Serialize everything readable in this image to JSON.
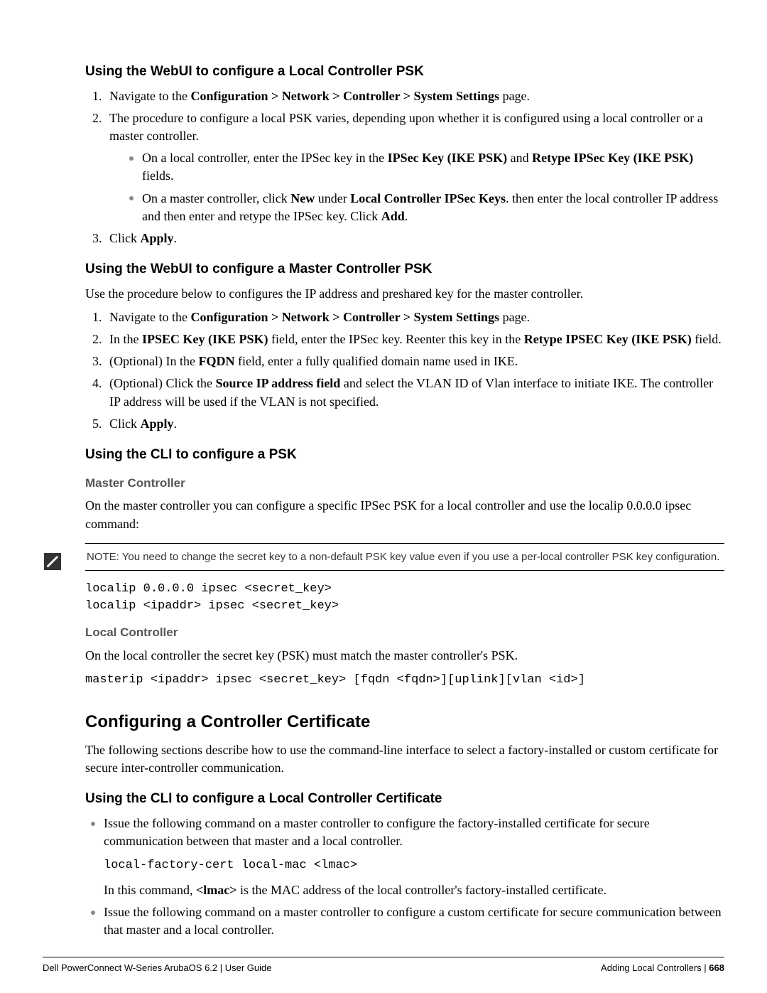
{
  "h1": "Using the WebUI to configure a Local Controller PSK",
  "s1_li1_a": "Navigate to the ",
  "s1_li1_b": "Configuration > Network > Controller > System Settings",
  "s1_li1_c": " page.",
  "s1_li2": "The procedure to configure a local PSK varies, depending upon whether it is configured using a local controller or a master controller.",
  "s1_li2_s1_a": "On a local controller, enter the IPSec key in the ",
  "s1_li2_s1_b": "IPSec Key (IKE PSK)",
  "s1_li2_s1_c": " and ",
  "s1_li2_s1_d": "Retype IPSec Key (IKE PSK)",
  "s1_li2_s1_e": " fields.",
  "s1_li2_s2_a": "On a master controller, click ",
  "s1_li2_s2_b": "New",
  "s1_li2_s2_c": " under ",
  "s1_li2_s2_d": "Local Controller IPSec Keys",
  "s1_li2_s2_e": ". then enter the local controller IP address and then enter and retype the IPSec key. Click ",
  "s1_li2_s2_f": "Add",
  "s1_li2_s2_g": ".",
  "s1_li3_a": "Click ",
  "s1_li3_b": "Apply",
  "s1_li3_c": ".",
  "h2": "Using the WebUI to configure a Master Controller PSK",
  "s2_p1": "Use the procedure below to configures the IP address and preshared key for the master controller.",
  "s2_li1_a": "Navigate to the ",
  "s2_li1_b": "Configuration > Network > Controller > System Settings",
  "s2_li1_c": " page.",
  "s2_li2_a": "In the ",
  "s2_li2_b": "IPSEC Key (IKE PSK)",
  "s2_li2_c": " field, enter the IPSec key. Reenter this key in the ",
  "s2_li2_d": "Retype IPSEC Key (IKE PSK)",
  "s2_li2_e": " field.",
  "s2_li3_a": "(Optional) In the ",
  "s2_li3_b": "FQDN",
  "s2_li3_c": " field, enter a fully qualified domain name used in IKE.",
  "s2_li4_a": "(Optional) Click the ",
  "s2_li4_b": "Source IP address field",
  "s2_li4_c": " and select the VLAN ID of Vlan interface to initiate IKE. The controller IP address will be used if the VLAN is not specified.",
  "s2_li5_a": "Click ",
  "s2_li5_b": "Apply",
  "s2_li5_c": ".",
  "h3": "Using the CLI to configure a PSK",
  "h3_sub1": "Master Controller",
  "s3_p1": "On the master controller you can configure a specific IPSec PSK for a local controller and use the localip 0.0.0.0 ipsec command:",
  "note1": "NOTE: You need to change the secret key to a non-default PSK key value even if you use a per-local controller PSK key configuration.",
  "code1": "localip 0.0.0.0 ipsec <secret_key>\nlocalip <ipaddr> ipsec <secret_key>",
  "h3_sub2": "Local Controller",
  "s3_p2": "On the local controller the secret key (PSK) must match the master controller's PSK.",
  "code2": "masterip <ipaddr> ipsec <secret_key> [fqdn <fqdn>][uplink][vlan <id>]",
  "h4": "Configuring a Controller Certificate",
  "s4_p1": "The following sections describe how to use the command-line interface to select a factory-installed or custom certificate for secure inter-controller communication.",
  "h5": "Using the CLI to configure a Local Controller Certificate",
  "s5_li1": "Issue the following command on a master controller to configure the factory-installed certificate for secure communication between that master and a local controller.",
  "code3": "local-factory-cert local-mac <lmac>",
  "s5_p_after_code_a": "In this command, ",
  "s5_p_after_code_b": "<lmac>",
  "s5_p_after_code_c": " is the MAC address of the local controller's factory-installed certificate.",
  "s5_li2": "Issue the following command on a master controller to configure a custom certificate for secure communication between that master and a local controller.",
  "footer_left": "Dell PowerConnect W-Series ArubaOS 6.2 | User Guide",
  "footer_right_a": "Adding Local Controllers",
  "footer_right_b": " | ",
  "footer_right_c": "668"
}
